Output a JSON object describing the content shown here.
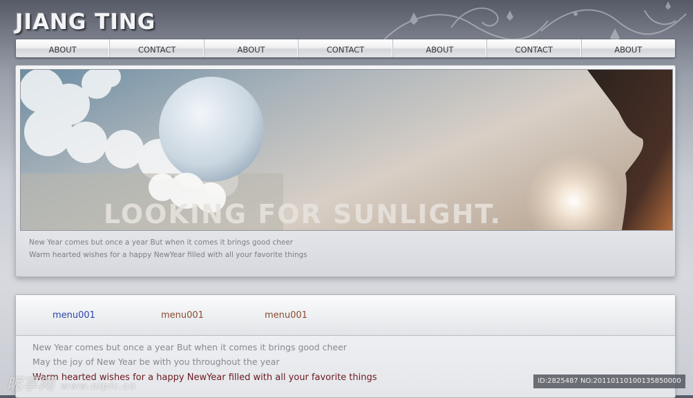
{
  "header": {
    "site_title": "JIANG TING"
  },
  "nav": {
    "items": [
      {
        "label": "ABOUT"
      },
      {
        "label": "CONTACT"
      },
      {
        "label": "ABOUT"
      },
      {
        "label": "CONTACT"
      },
      {
        "label": "ABOUT"
      },
      {
        "label": "CONTACT"
      },
      {
        "label": "ABOUT"
      }
    ]
  },
  "hero": {
    "banner_text": "LOOKING FOR SUNLIGHT.",
    "caption_line1": "New Year comes but once a year But when it comes it brings good cheer",
    "caption_line2": "Warm hearted wishes for a happy NewYear filled with all your favorite things"
  },
  "content": {
    "tabs": [
      {
        "label": "menu001"
      },
      {
        "label": "menu001"
      },
      {
        "label": "menu001"
      }
    ],
    "line1": "New Year comes but once a year But when it comes it brings good cheer",
    "line2": "May the joy of New Year be with you throughout the year",
    "line3": "Warm hearted wishes for a happy NewYear filled with all your favorite things"
  },
  "watermark": {
    "brand": "昵享网",
    "url": "www.nipic.cn",
    "id_text": "ID:2825487 NO:20110110100135850000"
  },
  "colors": {
    "tab_active": "#2b44a8",
    "tab_inactive": "#8a4b2f",
    "highlight_text": "#6b1a1f"
  }
}
